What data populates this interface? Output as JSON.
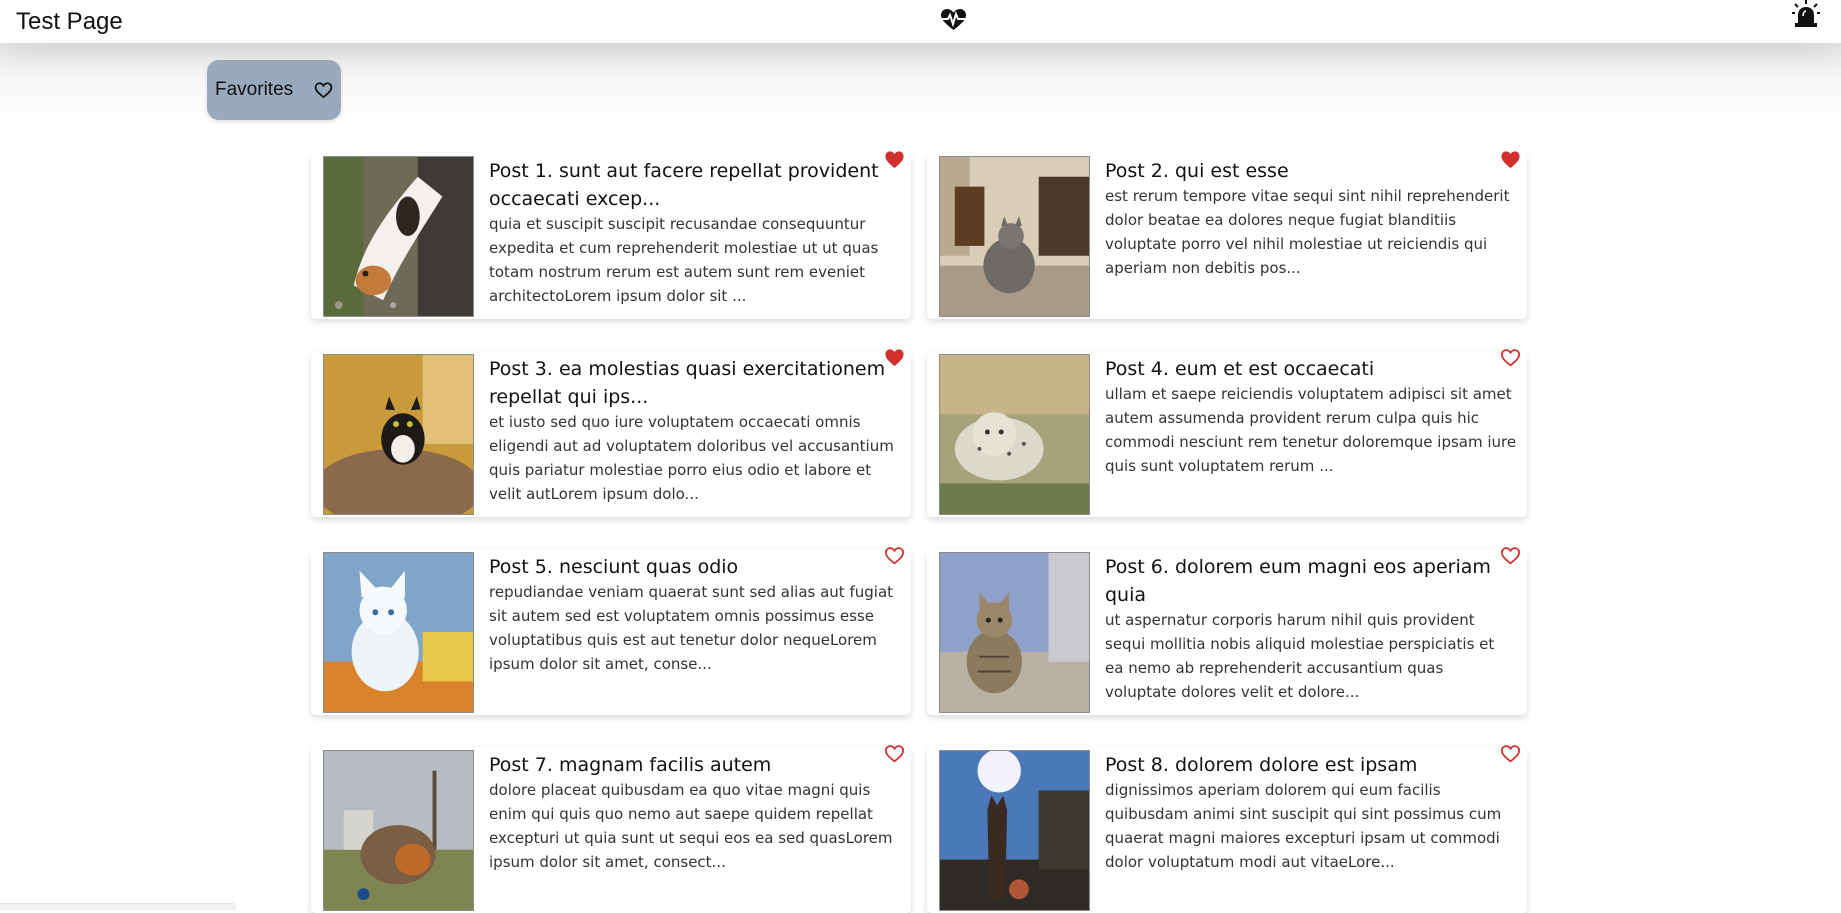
{
  "header": {
    "title": "Test Page",
    "center_icon": "heart-pulse-icon",
    "right_icon": "alarm-siren-icon"
  },
  "favorites_button": {
    "label": "Favorites",
    "icon": "heart-outline-icon"
  },
  "colors": {
    "favorite_button_bg": "#9aa9bd",
    "heart_active": "#d32f2f"
  },
  "posts": [
    {
      "title": "Post 1. sunt aut facere repellat provident occaecati excep...",
      "body": "quia et suscipit suscipit recusandae consequuntur expedita et cum reprehenderit molestiae ut ut quas totam nostrum rerum est autem sunt rem eveniet architectoLorem ipsum dolor sit ...",
      "favorite": true,
      "image": "calico-cat-lying"
    },
    {
      "title": "Post 2. qui est esse",
      "body": "est rerum tempore vitae sequi sint nihil reprehenderit dolor beatae ea dolores neque fugiat blanditiis voluptate porro vel nihil molestiae ut reiciendis qui aperiam non debitis pos...",
      "favorite": true,
      "image": "gray-cat-indoors"
    },
    {
      "title": "Post 3. ea molestias quasi exercitationem repellat qui ips...",
      "body": "et iusto sed quo iure voluptatem occaecati omnis eligendi aut ad voluptatem doloribus vel accusantium quis pariatur molestiae porro eius odio et labore et velit autLorem ipsum dolo...",
      "favorite": true,
      "image": "tuxedo-cat-on-fur"
    },
    {
      "title": "Post 4. eum et est occaecati",
      "body": "ullam et saepe reiciendis voluptatem adipisci sit amet autem assumenda provident rerum culpa quis hic commodi nesciunt rem tenetur doloremque ipsam iure quis sunt voluptatem rerum ...",
      "favorite": false,
      "image": "snow-leopard-cubs"
    },
    {
      "title": "Post 5. nesciunt quas odio",
      "body": "repudiandae veniam quaerat sunt sed alias aut fugiat sit autem sed est voluptatem omnis possimus esse voluptatibus quis est aut tenetur dolor nequeLorem ipsum dolor sit amet, conse...",
      "favorite": false,
      "image": "white-kitten-painting"
    },
    {
      "title": "Post 6. dolorem eum magni eos aperiam quia",
      "body": "ut aspernatur corporis harum nihil quis provident sequi mollitia nobis aliquid molestiae perspiciatis et ea nemo ab reprehenderit accusantium quas voluptate dolores velit et dolore...",
      "favorite": false,
      "image": "tabby-kitten-lying"
    },
    {
      "title": "Post 7. magnam facilis autem",
      "body": "dolore placeat quibusdam ea quo vitae magni quis enim qui quis quo nemo aut saepe quidem repellat excepturi ut quia sunt ut sequi eos ea sed quasLorem ipsum dolor sit amet, consect...",
      "favorite": false,
      "image": "cat-playing-outdoors"
    },
    {
      "title": "Post 8. dolorem dolore est ipsam",
      "body": "dignissimos aperiam dolorem qui eum facilis quibusdam animi sint suscipit qui sint possimus cum quaerat magni maiores excepturi ipsam ut commodi dolor voluptatum modi aut vitaeLore...",
      "favorite": false,
      "image": "cat-silhouette-sunlight"
    }
  ]
}
